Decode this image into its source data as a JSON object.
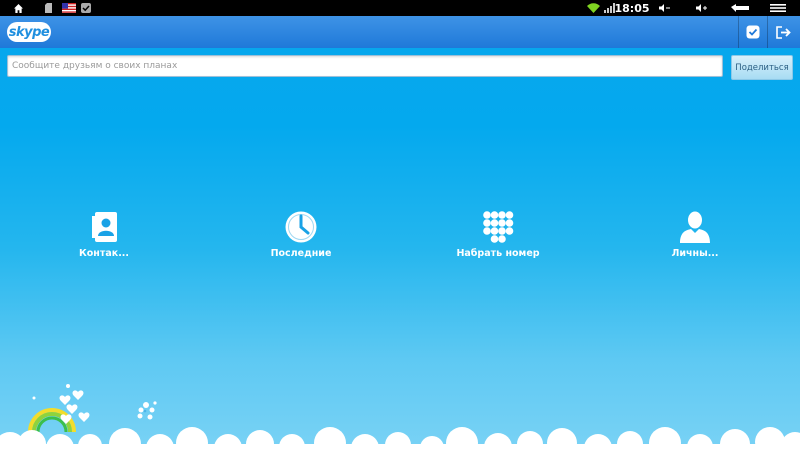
{
  "statusbar": {
    "time": "18:05"
  },
  "appbar": {
    "logo_text": "skype"
  },
  "status_input": {
    "placeholder": "Сообщите друзьям о своих планах",
    "value": ""
  },
  "share_label": "Поделиться",
  "tiles": [
    {
      "label": "Контак...",
      "icon": "contacts-icon"
    },
    {
      "label": "Последние",
      "icon": "clock-icon"
    },
    {
      "label": "Набрать номер",
      "icon": "dialpad-icon"
    },
    {
      "label": "Личны...",
      "icon": "profile-icon"
    }
  ],
  "colors": {
    "accent": "#1f79d9",
    "background": "#04a9ee"
  }
}
